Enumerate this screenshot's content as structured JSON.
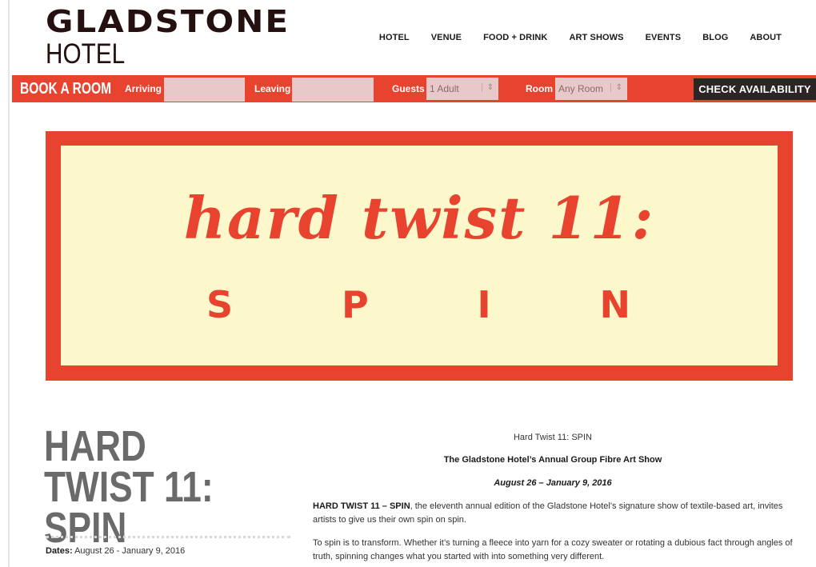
{
  "logo": {
    "line1": "GLADSTONE",
    "line2": "HOTEL"
  },
  "nav": [
    "HOTEL",
    "VENUE",
    "FOOD + DRINK",
    "ART SHOWS",
    "EVENTS",
    "BLOG",
    "ABOUT"
  ],
  "booking": {
    "title": "BOOK A ROOM",
    "arriving_label": "Arriving",
    "arriving_value": "",
    "leaving_label": "Leaving",
    "leaving_value": "",
    "guests_label": "Guests",
    "guests_value": "1 Adult",
    "room_label": "Room",
    "room_value": "Any Room",
    "check_button": "CHECK AVAILABILITY"
  },
  "banner": {
    "script": "hard twist 11:",
    "spin_letters": [
      "S",
      "P",
      "I",
      "N"
    ]
  },
  "page": {
    "title": "HARD TWIST 11: SPIN",
    "dates_label": "Dates:",
    "dates_value": " August 26 - January 9, 2016"
  },
  "article": {
    "title": "Hard Twist 11: SPIN",
    "subtitle": "The Gladstone Hotel’s Annual Group Fibre Art Show",
    "dates": "August 26 – January 9, 2016",
    "p1_bold": "HARD TWIST 11 – SPIN",
    "p1_rest": ", the eleventh annual edition of the Gladstone Hotel’s signature show of textile-based art, invites artists to give us their own spin on spin.",
    "p2": "To spin is to transform. Whether it’s turning a fleece into yarn for a cozy sweater or rotating a dubious fact through angles of truth, spinning changes what you started with into something very different."
  },
  "colors": {
    "brand_red": "#e8432e",
    "banner_bg": "#fdf8cc",
    "dark": "#2c2523"
  }
}
